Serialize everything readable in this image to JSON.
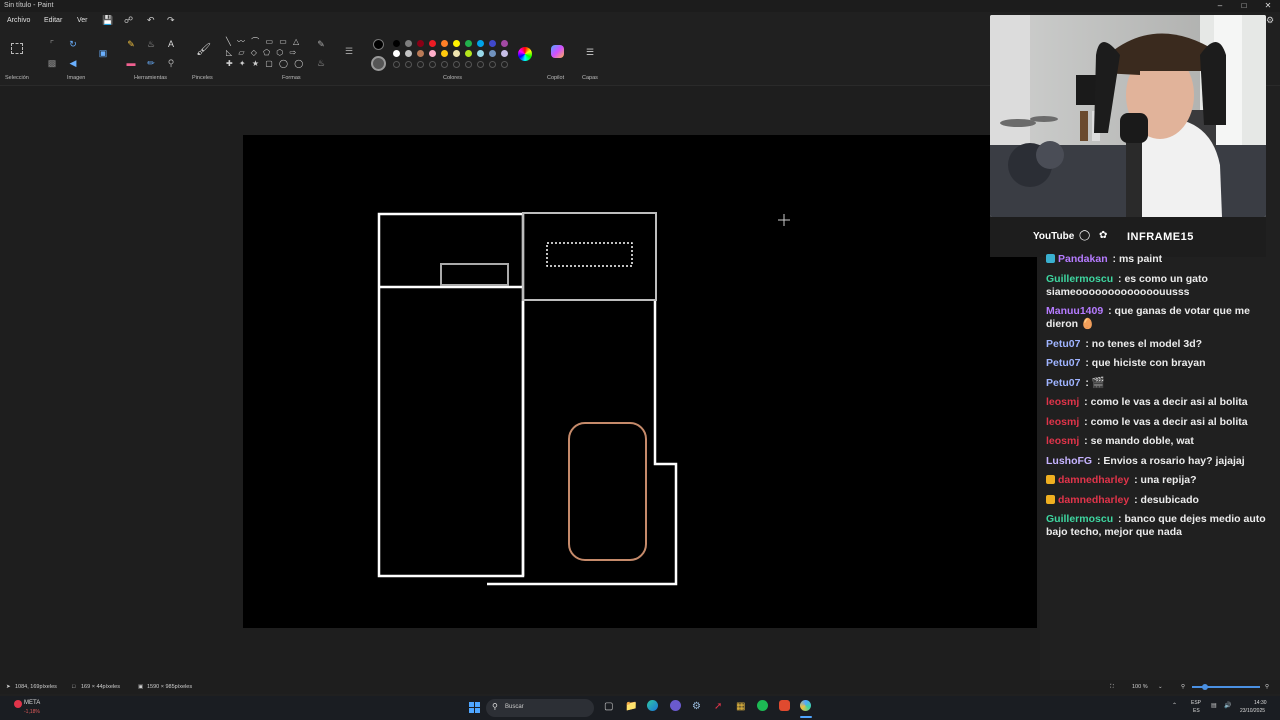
{
  "window": {
    "title": "Sin título - Paint"
  },
  "menu": {
    "archivo": "Archivo",
    "editar": "Editar",
    "ver": "Ver"
  },
  "ribbon": {
    "groups": {
      "seleccion": "Selección",
      "imagen": "Imagen",
      "herramientas": "Herramientas",
      "pinceles": "Pinceles",
      "formas": "Formas",
      "colores": "Colores",
      "copilot": "Copilot",
      "capas": "Capas"
    },
    "palette_row1": [
      "#000000",
      "#7f7f7f",
      "#880015",
      "#ed1c24",
      "#ff7f27",
      "#fff200",
      "#22b14c",
      "#00a2e8",
      "#3f48cc",
      "#a349a4"
    ],
    "palette_row2": [
      "#ffffff",
      "#c3c3c3",
      "#b97a57",
      "#ffaec9",
      "#ffc90e",
      "#efe4b0",
      "#b5e61d",
      "#99d9ea",
      "#7092be",
      "#c8bfe7"
    ]
  },
  "status": {
    "cursor_pos": "1084, 169píxeles",
    "selection_size": "169 × 44píxeles",
    "canvas_size": "1590 × 985píxeles",
    "zoom": "100 %"
  },
  "taskbar": {
    "stock_name": "META",
    "stock_change": "-1,18%",
    "search_placeholder": "Buscar",
    "lang": "ESP",
    "lang_sub": "ES",
    "time": "14:30",
    "date": "23/10/2025"
  },
  "overlay": {
    "youtube_label": "YouTube",
    "channel": "INFRAME15"
  },
  "chat": [
    {
      "user": "Pandakan",
      "color": "#b57bff",
      "text": "ms paint",
      "badge": "globe"
    },
    {
      "user": "Guillermoscu",
      "color": "#3ed6a0",
      "text": "es como un gato siameooooooooooooouusss"
    },
    {
      "user": "Manuu1409",
      "color": "#b57bff",
      "text": "que ganas de votar que me dieron 🥚"
    },
    {
      "user": "Petu07",
      "color": "#9fb4ff",
      "text": "no tenes el model 3d?"
    },
    {
      "user": "Petu07",
      "color": "#9fb4ff",
      "text": "que hiciste con brayan"
    },
    {
      "user": "Petu07",
      "color": "#9fb4ff",
      "text": "🎬"
    },
    {
      "user": "leosmj",
      "color": "#e0344a",
      "text": "como le vas a decir asi al bolita"
    },
    {
      "user": "leosmj",
      "color": "#e0344a",
      "text": "como le vas a decir asi al bolita"
    },
    {
      "user": "leosmj",
      "color": "#e0344a",
      "text": "se mando doble, wat"
    },
    {
      "user": "LushoFG",
      "color": "#c6b3ff",
      "text": "Envios a rosario hay? jajajaj"
    },
    {
      "user": "damnedharley",
      "color": "#e0344a",
      "text": "una repija?",
      "badge": "crown"
    },
    {
      "user": "damnedharley",
      "color": "#e0344a",
      "text": "desubicado",
      "badge": "crown"
    },
    {
      "user": "Guillermoscu",
      "color": "#3ed6a0",
      "text": "banco que dejes medio auto bajo techo, mejor que nada"
    }
  ]
}
